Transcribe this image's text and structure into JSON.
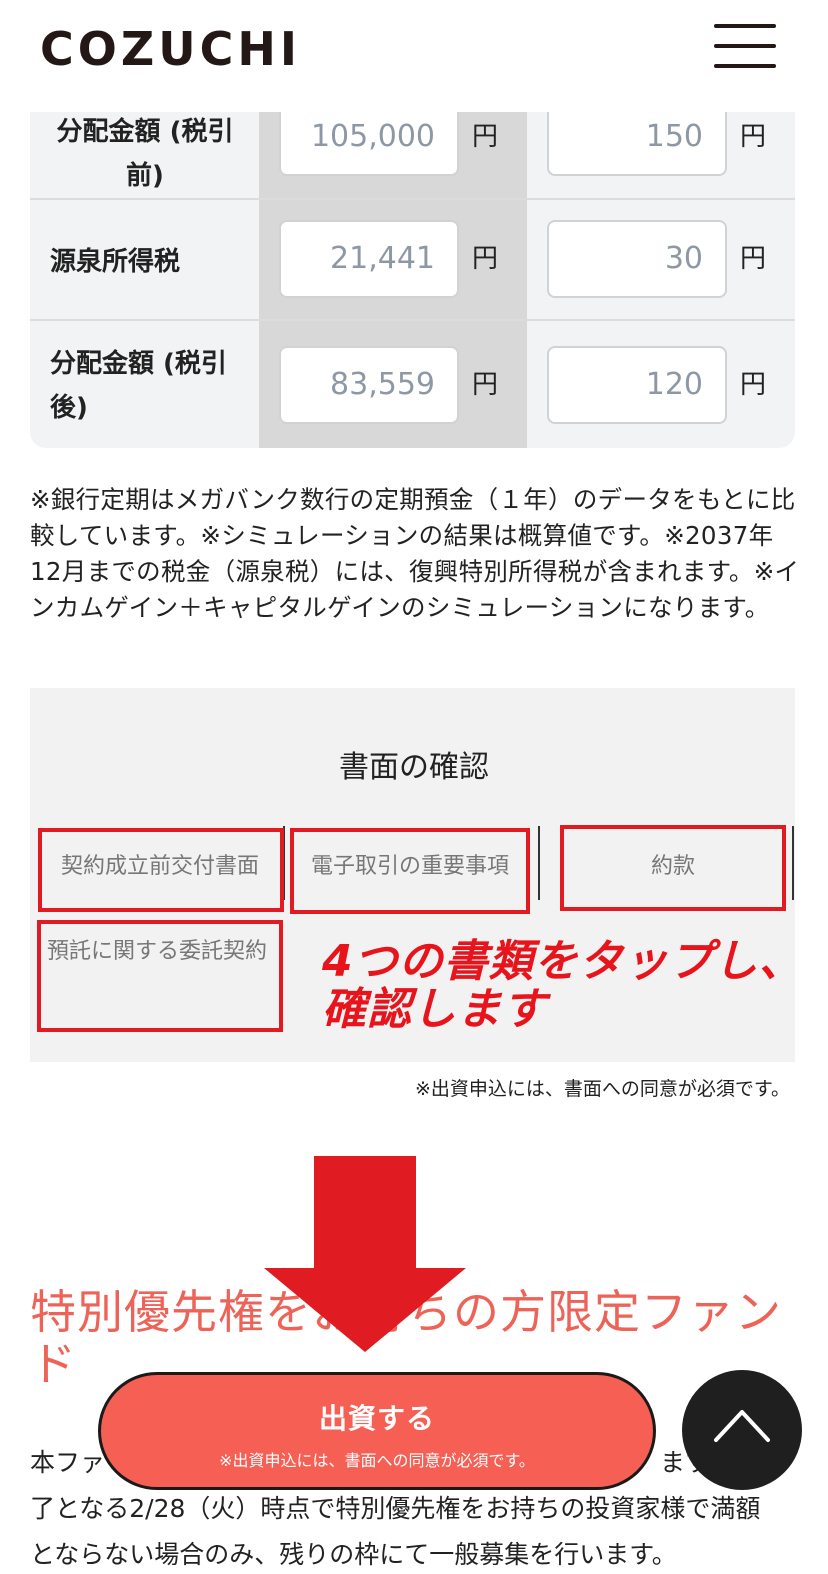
{
  "header": {
    "logo": "COZUCHI"
  },
  "simulation": {
    "unit": "円",
    "rows": [
      {
        "label": "分配金額 (税引前)",
        "value_a": "105,000",
        "value_b": "150"
      },
      {
        "label": "源泉所得税",
        "value_a": "21,441",
        "value_b": "30"
      },
      {
        "label": "分配金額 (税引後)",
        "value_a": "83,559",
        "value_b": "120"
      }
    ]
  },
  "notes": "※銀行定期はメガバンク数行の定期預金（１年）のデータをもとに比較しています。※シミュレーションの結果は概算値です。※2037年12月までの税金（源泉税）には、復興特別所得税が含まれます。※インカムゲイン＋キャピタルゲインのシミュレーションになります。",
  "documents": {
    "title": "書面の確認",
    "items": [
      "契約成立前交付書面",
      "電子取引の重要事項",
      "約款",
      "預託に関する委託契約"
    ],
    "annotation_line1": "4つの書類をタップし、",
    "annotation_line2": "確認します",
    "consent_note": "※出資申込には、書面への同意が必須です。"
  },
  "fund": {
    "heading": "特別優先権をお持ちの方限定ファンド",
    "body_1": "本ファ",
    "body_1_end": "ます",
    "body_2": "了となる2/28（火）時点で特別優先権をお持ちの投資家様で満額",
    "body_3": "とならない場合のみ、残りの枠にて一般募集を行います。"
  },
  "cta": {
    "label": "出資する",
    "sub": "※出資申込には、書面への同意が必須です。"
  },
  "colors": {
    "accent_red": "#e01b22",
    "cta": "#f55f54",
    "heading": "#ee6357"
  },
  "icons": {
    "menu": "hamburger-icon",
    "scroll_top": "chevron-up-icon",
    "arrow": "arrow-down-icon"
  }
}
